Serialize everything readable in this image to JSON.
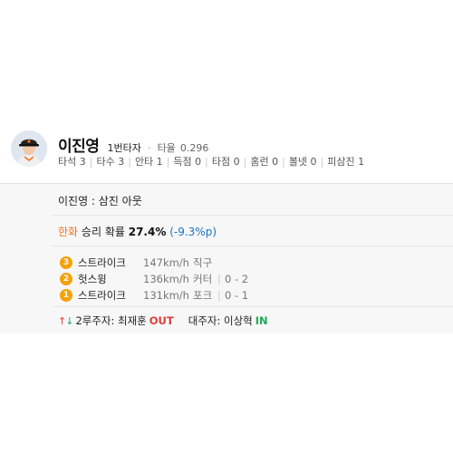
{
  "player": {
    "name": "이진영",
    "order": "1번타자",
    "avg_label": "타율",
    "avg_value": "0.296",
    "stats": [
      "타석 3",
      "타수 3",
      "안타 1",
      "득점 0",
      "타점 0",
      "홈런 0",
      "볼넷 0",
      "피삼진 1"
    ]
  },
  "result": "이진영 : 삼진 아웃",
  "win_prob": {
    "team": "한화",
    "label": "승리 확률",
    "value": "27.4%",
    "change": "(-9.3%p)"
  },
  "pitches": [
    {
      "num": "3",
      "type": "스트라이크",
      "speed": "147km/h",
      "kind": "직구",
      "count": ""
    },
    {
      "num": "2",
      "type": "헛스윙",
      "speed": "136km/h",
      "kind": "커터",
      "count": "0 - 2"
    },
    {
      "num": "1",
      "type": "스트라이크",
      "speed": "131km/h",
      "kind": "포크",
      "count": "0 - 1"
    }
  ],
  "runners": {
    "runner_text": "2루주자: 최재훈",
    "runner_status": "OUT",
    "sub_text": "대주자: 이상혁",
    "sub_status": "IN"
  },
  "colors": {
    "team": "#f37321",
    "change": "#1a73c9",
    "badge": "#f5a20a",
    "out": "#e03c3c",
    "in": "#1fa85b"
  }
}
